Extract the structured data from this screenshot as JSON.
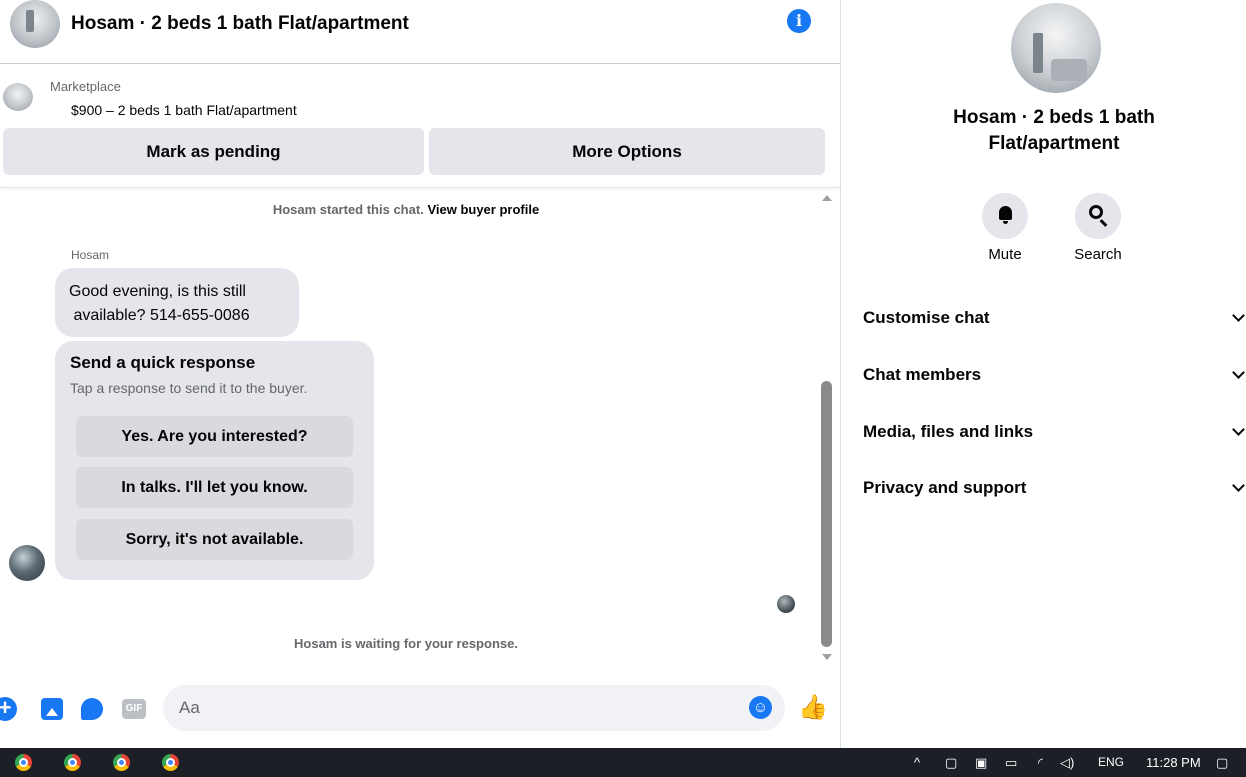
{
  "header": {
    "title": "Hosam · 2 beds 1 bath Flat/apartment",
    "info_icon": "info-icon"
  },
  "marketplace": {
    "label": "Marketplace",
    "listing": "$900 – 2 beds 1 bath Flat/apartment",
    "mark_pending_label": "Mark as pending",
    "more_options_label": "More Options"
  },
  "conversation": {
    "started_text": "Hosam started this chat.",
    "view_profile_link": "View buyer profile",
    "sender_name": "Hosam",
    "message_line1": "Good evening, is this still",
    "message_line2": " available? 514-655-0086",
    "quick_title": "Send a quick response",
    "quick_subtitle": "Tap a response to send it to the buyer.",
    "quick_responses": [
      "Yes. Are you interested?",
      "In talks. I'll let you know.",
      "Sorry, it's not available."
    ],
    "waiting_text": "Hosam is waiting for your response."
  },
  "composer": {
    "placeholder": "Aa",
    "gif_label": "GIF",
    "icons": [
      "plus-icon",
      "photo-icon",
      "sticker-icon",
      "gif-icon",
      "emoji-icon",
      "like-icon"
    ]
  },
  "details": {
    "title": "Hosam · 2 beds 1 bath Flat/apartment",
    "mute_label": "Mute",
    "search_label": "Search",
    "sections": [
      "Customise chat",
      "Chat members",
      "Media, files and links",
      "Privacy and support"
    ]
  },
  "taskbar": {
    "language": "ENG",
    "time": "11:28 PM",
    "tray_up": "^"
  },
  "colors": {
    "accent": "#1877f2",
    "bubble": "#e4e6eb",
    "secondary_text": "#65676b",
    "taskbar": "#1c1f26"
  }
}
